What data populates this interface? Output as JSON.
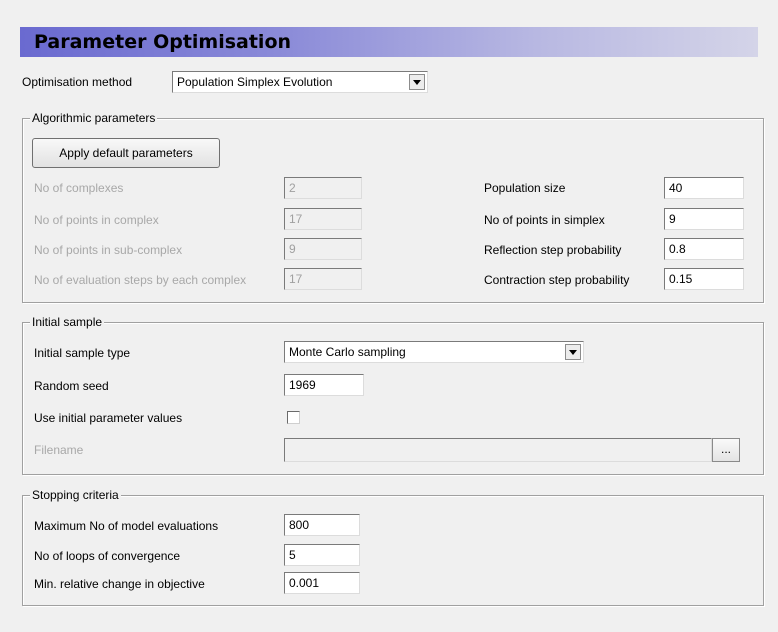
{
  "title": "Parameter Optimisation",
  "optimisation_method": {
    "label": "Optimisation method",
    "value": "Population Simplex Evolution"
  },
  "algorithmic": {
    "legend": "Algorithmic parameters",
    "apply_button": "Apply default parameters",
    "left": [
      {
        "label": "No of complexes",
        "value": "2"
      },
      {
        "label": "No of points in complex",
        "value": "17"
      },
      {
        "label": "No of points in sub-complex",
        "value": "9"
      },
      {
        "label": "No of evaluation steps by each complex",
        "value": "17"
      }
    ],
    "right": [
      {
        "label": "Population size",
        "value": "40"
      },
      {
        "label": "No of points in simplex",
        "value": "9"
      },
      {
        "label": "Reflection step probability",
        "value": "0.8"
      },
      {
        "label": "Contraction step probability",
        "value": "0.15"
      }
    ]
  },
  "initial_sample": {
    "legend": "Initial sample",
    "type_label": "Initial sample type",
    "type_value": "Monte Carlo sampling",
    "seed_label": "Random seed",
    "seed_value": "1969",
    "use_initial_label": "Use initial parameter values",
    "filename_label": "Filename",
    "filename_value": "",
    "browse_label": "..."
  },
  "stopping": {
    "legend": "Stopping criteria",
    "items": [
      {
        "label": "Maximum No of model evaluations",
        "value": "800"
      },
      {
        "label": "No of loops of convergence",
        "value": "5"
      },
      {
        "label": "Min. relative change in objective",
        "value": "0.001"
      }
    ]
  }
}
